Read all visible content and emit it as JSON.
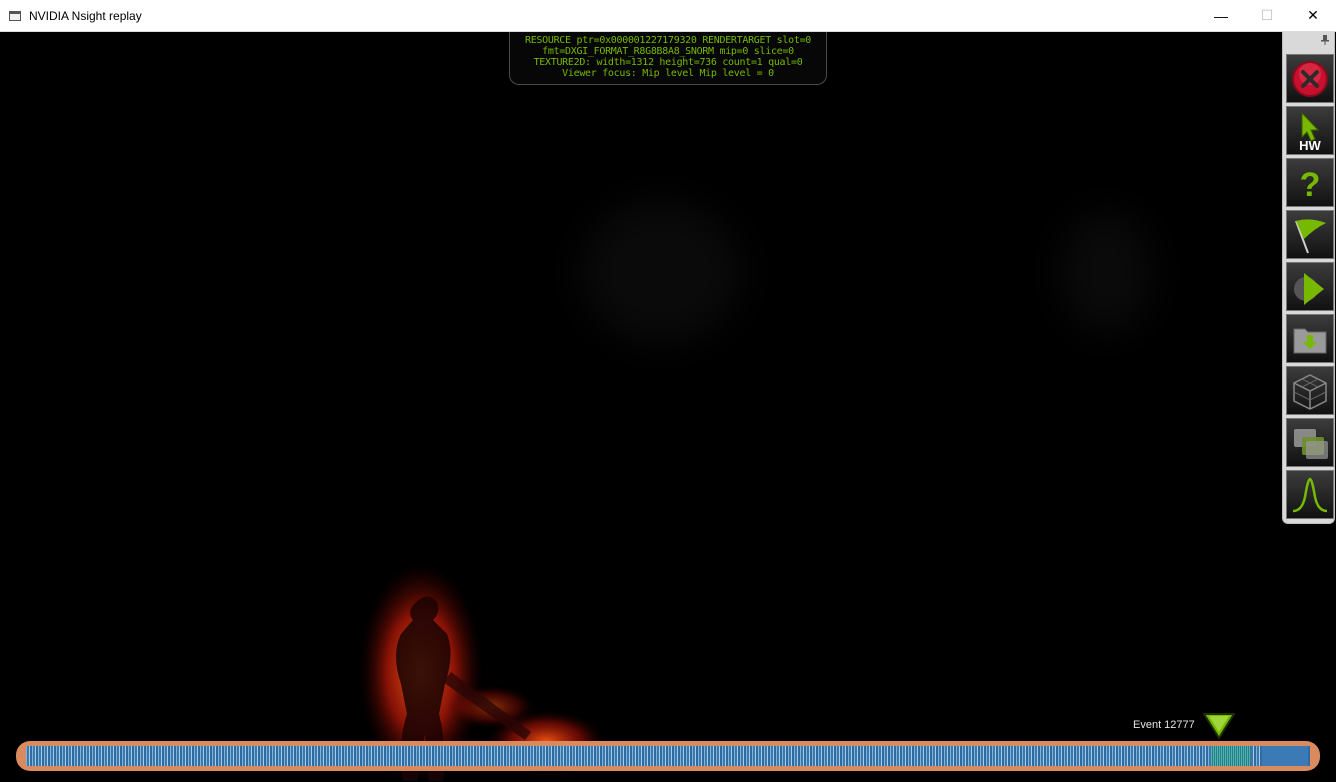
{
  "window": {
    "title": "NVIDIA Nsight replay",
    "controls": {
      "minimize": "—",
      "maximize": "☐",
      "close": "✕"
    }
  },
  "hud": {
    "lines": [
      "RESOURCE ptr=0x000001227179320 RENDERTARGET slot=0",
      "fmt=DXGI_FORMAT_R8G8B8A8_SNORM mip=0 slice=0",
      "TEXTURE2D: width=1312 height=736 count=1 qual=0",
      "Viewer focus: Mip level Mip level = 0"
    ],
    "color": "#76b900"
  },
  "toolbar": {
    "items": [
      {
        "name": "close-capture",
        "icon": "red-x-circle-icon"
      },
      {
        "name": "hw-cursor",
        "icon": "cursor-icon",
        "label": "HW"
      },
      {
        "name": "help",
        "icon": "question-mark-icon",
        "label": "?"
      },
      {
        "name": "flag",
        "icon": "flag-icon"
      },
      {
        "name": "play",
        "icon": "play-icon"
      },
      {
        "name": "save",
        "icon": "folder-download-icon"
      },
      {
        "name": "geometry",
        "icon": "wireframe-cube-icon"
      },
      {
        "name": "overlay",
        "icon": "overlapping-squares-icon"
      },
      {
        "name": "graph",
        "icon": "bell-curve-icon"
      }
    ],
    "accent": "#76b900"
  },
  "timeline": {
    "event_label": "Event 12777",
    "bar_color": "#d98a5f",
    "track_color": "#3d78ad"
  }
}
